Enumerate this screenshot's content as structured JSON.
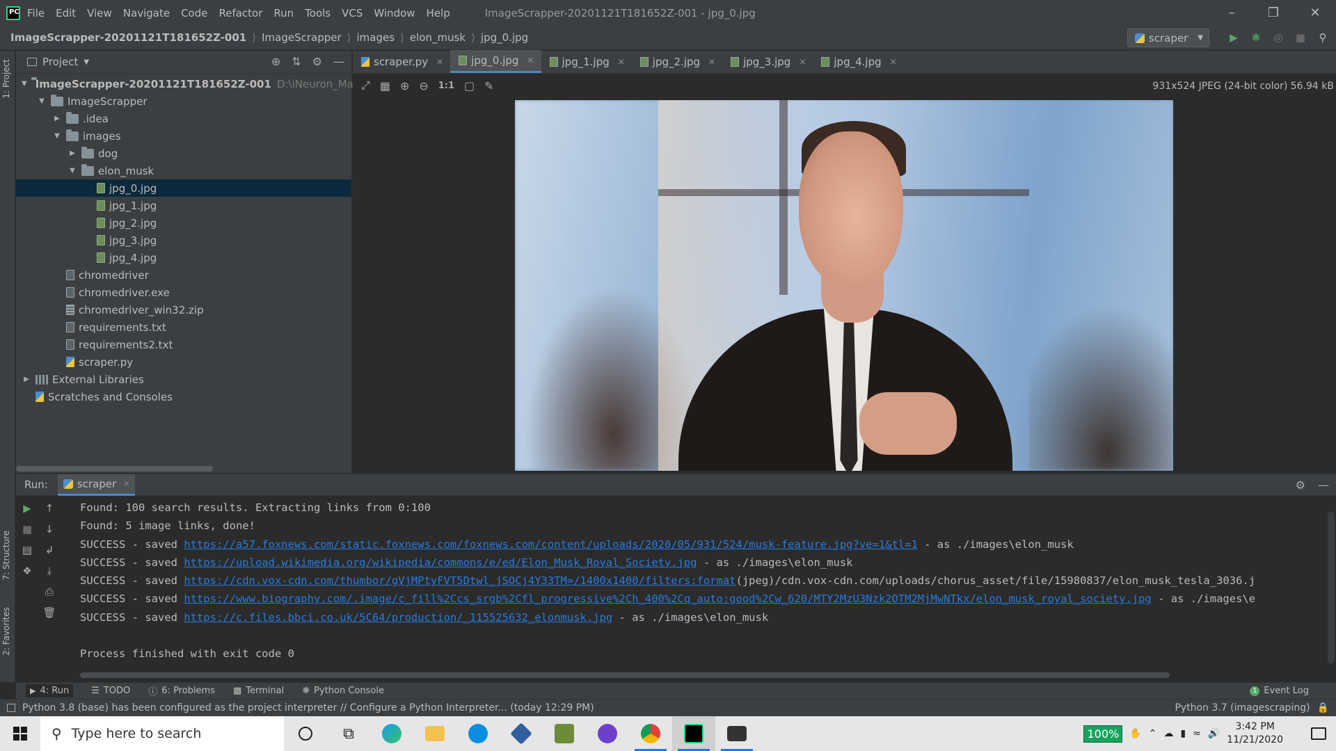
{
  "titlebar": {
    "menu": [
      "File",
      "Edit",
      "View",
      "Navigate",
      "Code",
      "Refactor",
      "Run",
      "Tools",
      "VCS",
      "Window",
      "Help"
    ],
    "title": "ImageScrapper-20201121T181652Z-001 - jpg_0.jpg"
  },
  "breadcrumb": [
    "ImageScrapper-20201121T181652Z-001",
    "ImageScrapper",
    "images",
    "elon_musk",
    "jpg_0.jpg"
  ],
  "run_config": "scraper",
  "leftstripe": {
    "project": "1: Project",
    "structure": "7: Structure",
    "favorites": "2: Favorites"
  },
  "project": {
    "title": "Project",
    "tree": [
      {
        "label": "ImageScrapper-20201121T181652Z-001",
        "path": "D:\\iNeuron_Machine",
        "kind": "root"
      },
      {
        "label": "ImageScrapper",
        "kind": "folder"
      },
      {
        "label": ".idea",
        "kind": "folder"
      },
      {
        "label": "images",
        "kind": "folder"
      },
      {
        "label": "dog",
        "kind": "folder"
      },
      {
        "label": "elon_musk",
        "kind": "folder"
      },
      {
        "label": "jpg_0.jpg",
        "kind": "img",
        "selected": true
      },
      {
        "label": "jpg_1.jpg",
        "kind": "img"
      },
      {
        "label": "jpg_2.jpg",
        "kind": "img"
      },
      {
        "label": "jpg_3.jpg",
        "kind": "img"
      },
      {
        "label": "jpg_4.jpg",
        "kind": "img"
      },
      {
        "label": "chromedriver",
        "kind": "file"
      },
      {
        "label": "chromedriver.exe",
        "kind": "file"
      },
      {
        "label": "chromedriver_win32.zip",
        "kind": "zip"
      },
      {
        "label": "requirements.txt",
        "kind": "file"
      },
      {
        "label": "requirements2.txt",
        "kind": "file"
      },
      {
        "label": "scraper.py",
        "kind": "py"
      },
      {
        "label": "External Libraries",
        "kind": "lib"
      },
      {
        "label": "Scratches and Consoles",
        "kind": "scratch"
      }
    ]
  },
  "tabs": [
    {
      "label": "scraper.py",
      "icon": "py"
    },
    {
      "label": "jpg_0.jpg",
      "icon": "img",
      "active": true
    },
    {
      "label": "jpg_1.jpg",
      "icon": "img"
    },
    {
      "label": "jpg_2.jpg",
      "icon": "img"
    },
    {
      "label": "jpg_3.jpg",
      "icon": "img"
    },
    {
      "label": "jpg_4.jpg",
      "icon": "img"
    }
  ],
  "image": {
    "info": "931x524 JPEG (24-bit color) 56.94 kB",
    "zoom_label": "1:1"
  },
  "run": {
    "label": "Run:",
    "tab": "scraper",
    "console": [
      {
        "prefix": "Found: 100 search results. Extracting links from 0:100",
        "link": "",
        "suffix": ""
      },
      {
        "prefix": "Found: 5 image links, done!",
        "link": "",
        "suffix": ""
      },
      {
        "prefix": "SUCCESS - saved ",
        "link": "https://a57.foxnews.com/static.foxnews.com/foxnews.com/content/uploads/2020/05/931/524/musk-feature.jpg?ve=1&tl=1",
        "suffix": " - as ./images\\elon_musk"
      },
      {
        "prefix": "SUCCESS - saved ",
        "link": "https://upload.wikimedia.org/wikipedia/commons/e/ed/Elon_Musk_Royal_Society.jpg",
        "suffix": " - as ./images\\elon_musk"
      },
      {
        "prefix": "SUCCESS - saved ",
        "link": "https://cdn.vox-cdn.com/thumbor/gVjMPtyFVT5Dtwl_jSOCj4Y33TM=/1400x1400/filters:format",
        "suffix": "(jpeg)/cdn.vox-cdn.com/uploads/chorus_asset/file/15980837/elon_musk_tesla_3036.j"
      },
      {
        "prefix": "SUCCESS - saved ",
        "link": "https://www.biography.com/.image/c_fill%2Ccs_srgb%2Cfl_progressive%2Ch_400%2Cq_auto:good%2Cw_620/MTY2MzU3Nzk2OTM2MjMwNTkx/elon_musk_royal_society.jpg",
        "suffix": " - as ./images\\e"
      },
      {
        "prefix": "SUCCESS - saved ",
        "link": "https://c.files.bbci.co.uk/5C64/production/_115525632_elonmusk.jpg",
        "suffix": " - as ./images\\elon_musk"
      },
      {
        "prefix": "",
        "link": "",
        "suffix": ""
      },
      {
        "prefix": "Process finished with exit code 0",
        "link": "",
        "suffix": ""
      }
    ]
  },
  "bottomtools": {
    "run": "4: Run",
    "todo": "TODO",
    "problems": "6: Problems",
    "terminal": "Terminal",
    "python_console": "Python Console",
    "event_count": "1",
    "event_log": "Event Log"
  },
  "statusbar": {
    "message": "Python 3.8 (base) has been configured as the project interpreter // Configure a Python Interpreter... (today 12:29 PM)",
    "interpreter": "Python 3.7 (imagescraping)"
  },
  "taskbar": {
    "search_placeholder": "Type here to search",
    "battery": "100%",
    "time": "3:42 PM",
    "date": "11/21/2020",
    "apps": [
      "cortana",
      "task-view",
      "edge",
      "file-explorer",
      "skype",
      "virtualbox",
      "gimp",
      "github-desktop",
      "chrome",
      "pycharm",
      "terminal"
    ]
  },
  "colors": {
    "accent": "#4a88c7",
    "link": "#287bde",
    "selection": "#0d293e",
    "run_green": "#59a869"
  }
}
